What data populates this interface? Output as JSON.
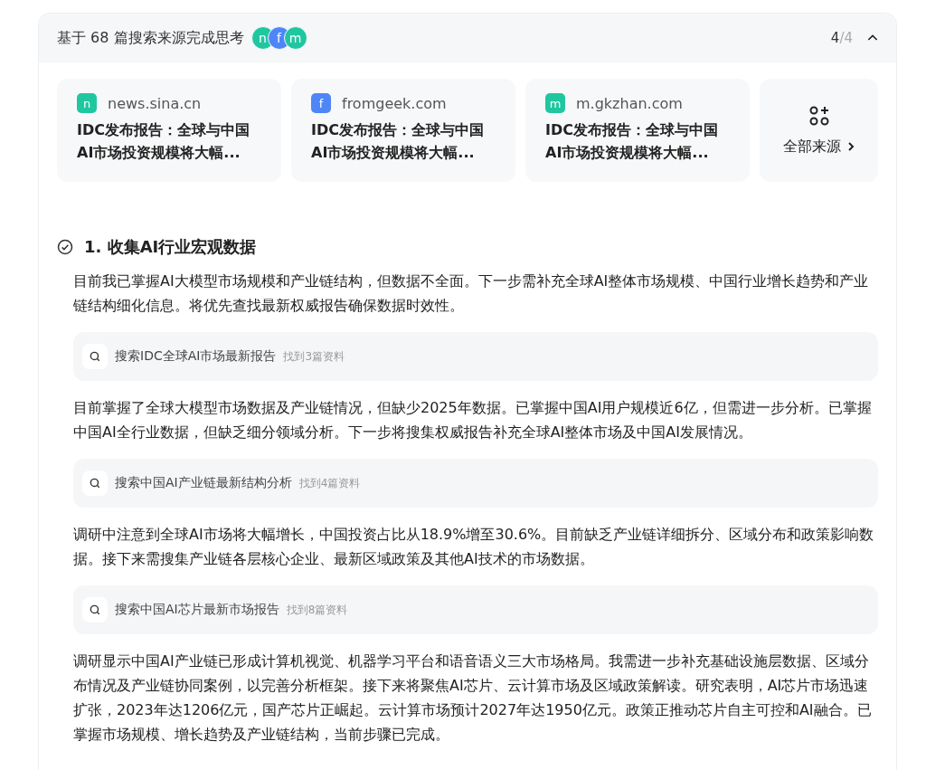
{
  "header": {
    "title": "基于 68 篇搜索来源完成思考",
    "avatars": [
      {
        "letter": "n",
        "color": "#1fc7a0"
      },
      {
        "letter": "f",
        "color": "#4f86f7"
      },
      {
        "letter": "m",
        "color": "#1fc7a0"
      }
    ],
    "counter": {
      "current": "4",
      "total": "/4"
    },
    "expanded": true
  },
  "sources": [
    {
      "letter": "n",
      "color": "#1fc7a0",
      "domain": "news.sina.cn",
      "title_lines": [
        "IDC发布报告：全球与中国",
        "AI市场投资规模将大幅..."
      ]
    },
    {
      "letter": "f",
      "color": "#4f86f7",
      "domain": "fromgeek.com",
      "title_lines": [
        "IDC发布报告：全球与中国",
        "AI市场投资规模将大幅..."
      ]
    },
    {
      "letter": "m",
      "color": "#1fc7a0",
      "domain": "m.gkzhan.com",
      "title_lines": [
        "IDC发布报告：全球与中国",
        "AI市场投资规模将大幅..."
      ]
    }
  ],
  "all_sources": {
    "label": "全部来源"
  },
  "step": {
    "title": "1. 收集AI行业宏观数据",
    "done": true,
    "items": [
      {
        "kind": "paragraph",
        "text": "目前我已掌握AI大模型市场规模和产业链结构，但数据不全面。下一步需补充全球AI整体市场规模、中国行业增长趋势和产业链结构细化信息。将优先查找最新权威报告确保数据时效性。"
      },
      {
        "kind": "search",
        "query": "搜索IDC全球AI市场最新报告",
        "result": "找到3篇资料"
      },
      {
        "kind": "paragraph",
        "text": "目前掌握了全球大模型市场数据及产业链情况，但缺少2025年数据。已掌握中国AI用户规模近6亿，但需进一步分析。已掌握中国AI全行业数据，但缺乏细分领域分析。下一步将搜集权威报告补充全球AI整体市场及中国AI发展情况。"
      },
      {
        "kind": "search",
        "query": "搜索中国AI产业链最新结构分析",
        "result": "找到4篇资料"
      },
      {
        "kind": "paragraph",
        "text": "调研中注意到全球AI市场将大幅增长，中国投资占比从18.9%增至30.6%。目前缺乏产业链详细拆分、区域分布和政策影响数据。接下来需搜集产业链各层核心企业、最新区域政策及其他AI技术的市场数据。"
      },
      {
        "kind": "search",
        "query": "搜索中国AI芯片最新市场报告",
        "result": "找到8篇资料"
      },
      {
        "kind": "paragraph",
        "text": "调研显示中国AI产业链已形成计算机视觉、机器学习平台和语音语义三大市场格局。我需进一步补充基础设施层数据、区域分布情况及产业链协同案例，以完善分析框架。接下来将聚焦AI芯片、云计算市场及区域政策解读。研究表明，AI芯片市场迅速扩张，2023年达1206亿元，国产芯片正崛起。云计算市场预计2027年达1950亿元。政策正推动芯片自主可控和AI融合。已掌握市场规模、增长趋势及产业链结构，当前步骤已完成。"
      }
    ]
  }
}
